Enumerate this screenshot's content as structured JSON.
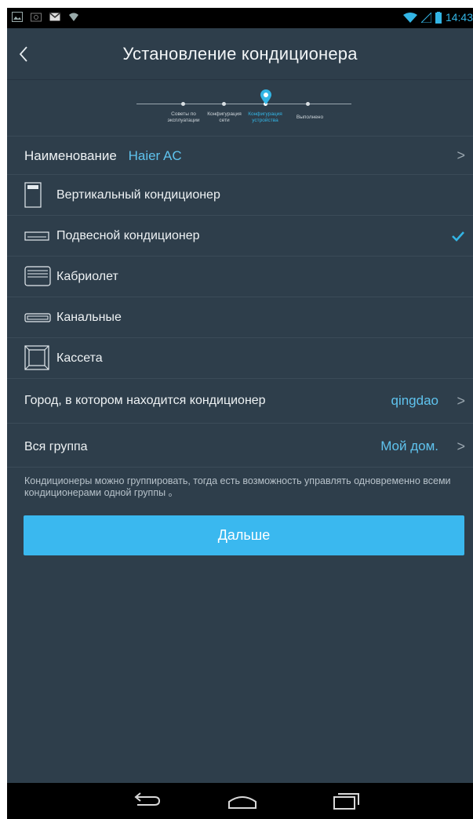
{
  "status_bar": {
    "time": "14:43"
  },
  "header": {
    "title": "Установление кондиционера"
  },
  "stepper": {
    "steps": [
      {
        "label_line1": "Советы по",
        "label_line2": "эксплуатации"
      },
      {
        "label_line1": "Конфигурация",
        "label_line2": "сети"
      },
      {
        "label_line1": "Конфигурация",
        "label_line2": "устройства"
      },
      {
        "label_line1": "Выполнено",
        "label_line2": ""
      }
    ],
    "active_step": 3
  },
  "name_row": {
    "label": "Наименование",
    "value": "Haier AC"
  },
  "ac_types": [
    {
      "label": "Вертикальный кондиционер",
      "icon": "vertical-ac-icon",
      "selected": false
    },
    {
      "label": "Подвесной кондиционер",
      "icon": "wall-ac-icon",
      "selected": true
    },
    {
      "label": "Кабриолет",
      "icon": "cabriolet-ac-icon",
      "selected": false
    },
    {
      "label": "Канальные",
      "icon": "duct-ac-icon",
      "selected": false
    },
    {
      "label": "Кассета",
      "icon": "cassette-ac-icon",
      "selected": false
    }
  ],
  "city_row": {
    "label": "Город, в котором находится кондиционер",
    "value": "qingdao"
  },
  "group_row": {
    "label": "Вся группа",
    "value": "Мой дом."
  },
  "note": "Кондиционеры можно группировать, тогда есть возможность управлять одновременно всеми кондиционерами одной группы 。",
  "next_button": {
    "label": "Дальше"
  },
  "colors": {
    "accent": "#33b5e5",
    "background": "#2e3e4b",
    "button": "#3ab8ef"
  }
}
